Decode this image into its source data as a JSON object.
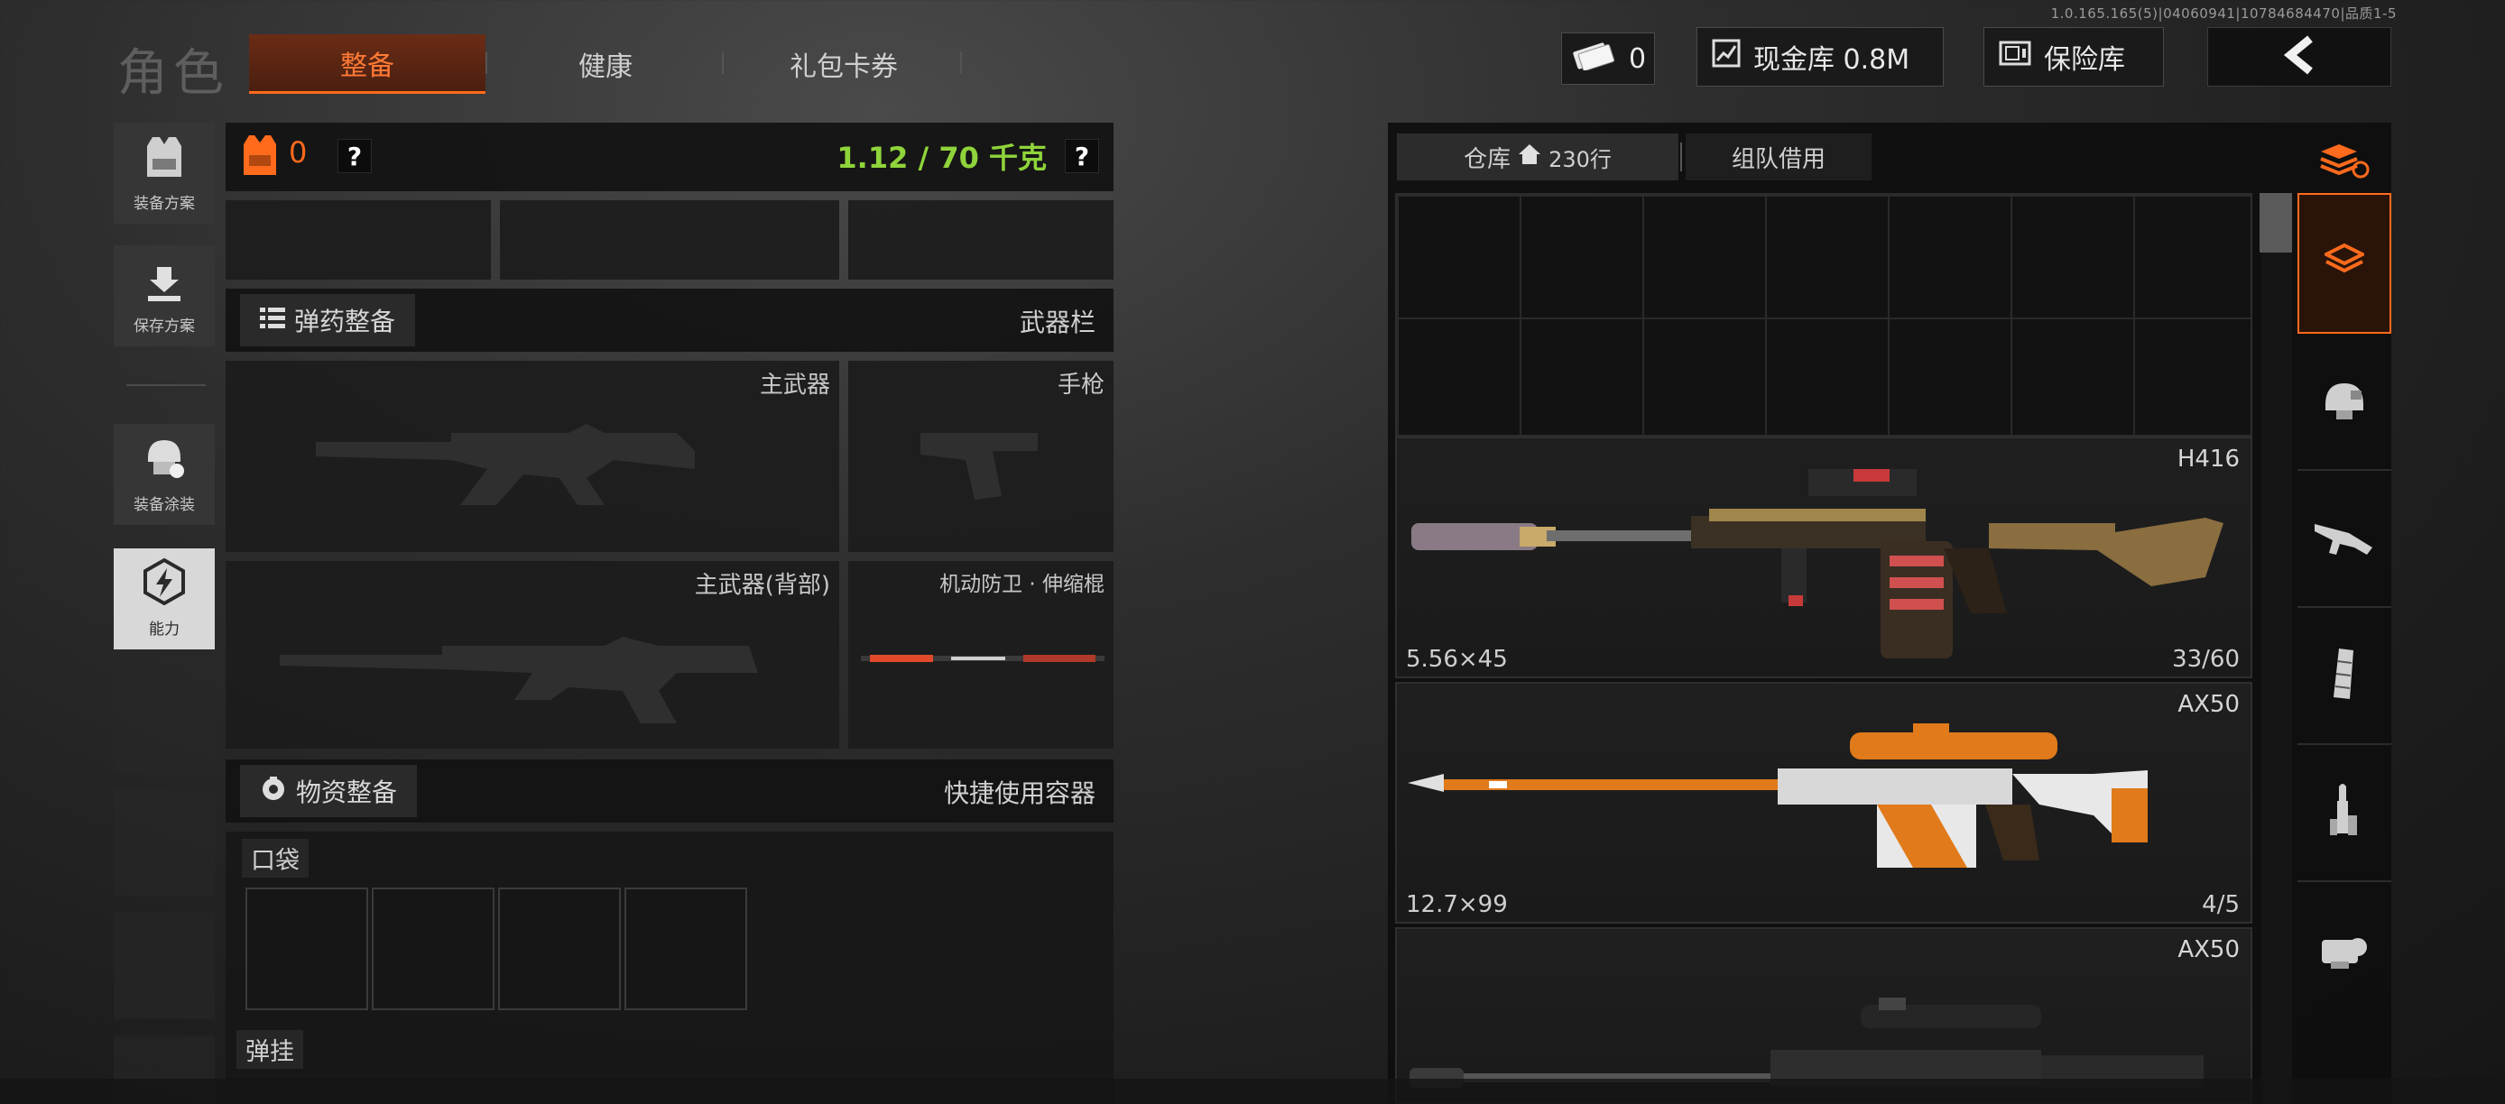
{
  "version": "1.0.165.165(5)|04060941|10784684470|品质1-5",
  "header": {
    "title": "角色",
    "tabs": [
      {
        "label": "整备",
        "active": true
      },
      {
        "label": "健康",
        "active": false
      },
      {
        "label": "礼包卡券",
        "active": false
      }
    ],
    "currency_value": "0",
    "cash_vault_label": "现金库 0.8M",
    "safe_label": "保险库"
  },
  "left_nav": [
    {
      "label": "装备方案",
      "icon": "vest-icon"
    },
    {
      "label": "保存方案",
      "icon": "download-icon"
    },
    {
      "label": "装备涂装",
      "icon": "helmet-paint-icon"
    },
    {
      "label": "能力",
      "icon": "ability-lightning-icon",
      "active": true
    }
  ],
  "loadout": {
    "armor_count": "0",
    "weight": "1.12 / 70 千克",
    "ammo_section": "弹药整备",
    "weapon_bar": "武器栏",
    "slots": {
      "primary": "主武器",
      "pistol": "手枪",
      "primary_back": "主武器(背部)",
      "melee": "机动防卫 · 伸缩棍"
    },
    "supplies_section": "物资整备",
    "quick_container": "快捷使用容器",
    "pocket": "口袋",
    "rig": "弹挂"
  },
  "warehouse": {
    "tab_storage": "仓库",
    "rows": "230行",
    "tab_team": "组队借用",
    "items": [
      {
        "name": "H416",
        "caliber": "5.56×45",
        "ammo": "33/60"
      },
      {
        "name": "AX50",
        "caliber": "12.7×99",
        "ammo": "4/5"
      },
      {
        "name": "AX50",
        "caliber": "",
        "ammo": ""
      }
    ]
  },
  "right_nav": [
    "sort-stack-icon",
    "storage-icon",
    "helmet-icon",
    "rifle-icon",
    "magazine-icon",
    "ammo-icon",
    "scope-icon"
  ],
  "colors": {
    "accent": "#ff6a1c",
    "weight_green": "#8fd43a"
  }
}
